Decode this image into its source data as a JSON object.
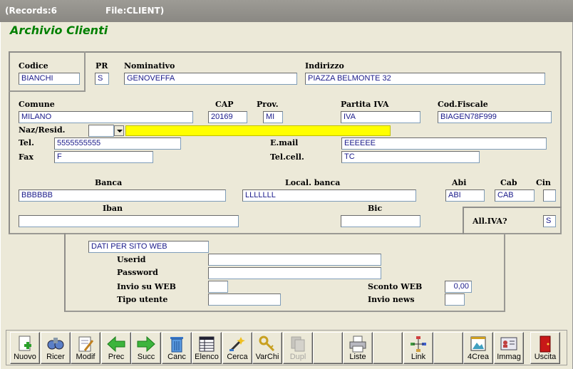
{
  "titlebar": {
    "records": "(Records:6",
    "file": "File:CLIENT)"
  },
  "form_title": "Archivio Clienti",
  "fields": {
    "codice": {
      "label": "Codice",
      "value": "BIANCHI"
    },
    "pr": {
      "label": "PR",
      "value": "S"
    },
    "nominativo": {
      "label": "Nominativo",
      "value": "GENOVEFFA"
    },
    "indirizzo": {
      "label": "Indirizzo",
      "value": "PIAZZA BELMONTE 32"
    },
    "comune": {
      "label": "Comune",
      "value": "MILANO"
    },
    "cap": {
      "label": "CAP",
      "value": "20169"
    },
    "prov": {
      "label": "Prov.",
      "value": "MI"
    },
    "piva": {
      "label": "Partita IVA",
      "value": "IVA"
    },
    "codfisc": {
      "label": "Cod.Fiscale",
      "value": "BIAGEN78F999"
    },
    "naz": {
      "label": "Naz/Resid.",
      "value": "",
      "desc": ""
    },
    "tel": {
      "label": "Tel.",
      "value": "5555555555"
    },
    "email": {
      "label": "E.mail",
      "value": "EEEEEE"
    },
    "fax": {
      "label": "Fax",
      "value": "F"
    },
    "telcell": {
      "label": "Tel.cell.",
      "value": "TC"
    },
    "banca": {
      "label": "Banca",
      "value": "BBBBBB"
    },
    "localbanca": {
      "label": "Local. banca",
      "value": "LLLLLLL"
    },
    "abi": {
      "label": "Abi",
      "value": "ABI"
    },
    "cab": {
      "label": "Cab",
      "value": "CAB"
    },
    "cin": {
      "label": "Cin",
      "value": ""
    },
    "iban": {
      "label": "Iban",
      "value": ""
    },
    "bic": {
      "label": "Bic",
      "value": ""
    },
    "alliva": {
      "label": "All.IVA?",
      "value": "S"
    }
  },
  "web": {
    "header": "DATI PER SITO WEB",
    "userid": {
      "label": "Userid",
      "value": ""
    },
    "password": {
      "label": "Password",
      "value": ""
    },
    "invio": {
      "label": "Invio su WEB",
      "value": ""
    },
    "tipo": {
      "label": "Tipo utente",
      "value": ""
    },
    "sconto": {
      "label": "Sconto WEB",
      "value": "0,00"
    },
    "news": {
      "label": "Invio news",
      "value": ""
    }
  },
  "toolbar": {
    "nuovo": "Nuovo",
    "ricer": "Ricer",
    "modif": "Modif",
    "prec": "Prec",
    "succ": "Succ",
    "canc": "Canc",
    "elenco": "Elenco",
    "cerca": "Cerca",
    "varchi": "VarChi",
    "dupl": "Dupl",
    "liste": "Liste",
    "link": "Link",
    "crea": "4Crea",
    "immag": "Immag",
    "uscita": "Uscita"
  }
}
